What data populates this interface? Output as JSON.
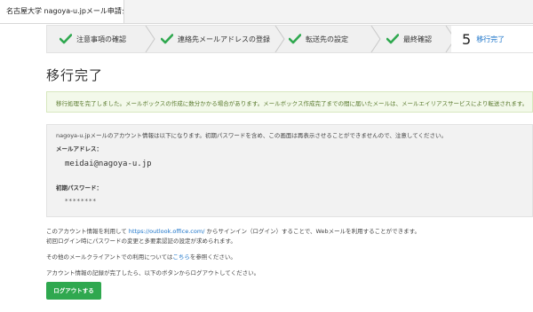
{
  "window": {
    "tab_title": "名古屋大学 nagoya-u.jpメール申請システム"
  },
  "steps": [
    {
      "label": "注意事項の確認",
      "state": "done"
    },
    {
      "label": "連絡先メールアドレスの登録",
      "state": "done"
    },
    {
      "label": "転送先の設定",
      "state": "done"
    },
    {
      "label": "最終確認",
      "state": "done"
    },
    {
      "number": "5",
      "label": "移行完了",
      "state": "current"
    }
  ],
  "page_title": "移行完了",
  "notice": "移行処理を完了しました。メールボックスの作成に数分かかる場合があります。メールボックス作成完了までの間に届いたメールは、メールエイリアスサービスにより転送されます。",
  "account": {
    "intro": "nagoya-u.jpメールのアカウント情報は以下になります。初期パスワードを含め、この画面は再表示させることができませんので、注意してください。",
    "email_label": "メールアドレス：",
    "email_value": "meidai@nagoya-u.jp",
    "password_label": "初期パスワード：",
    "password_value": "********"
  },
  "body_text": {
    "line1_prefix": "このアカウント情報を利用して ",
    "line1_link": "https://outlook.office.com/",
    "line1_suffix": " からサインイン（ログイン）することで、Webメールを利用することができます。",
    "line2": "初回ログイン時にパスワードの変更と多要素認証の設定が求められます。",
    "line3_prefix": "その他のメールクライアントでの利用については",
    "line3_link": "こちら",
    "line3_suffix": "を参照ください。",
    "line4": "アカウント情報の記録が完了したら、以下のボタンからログアウトしてください。"
  },
  "logout_button": "ログアウトする",
  "colors": {
    "accent_green": "#2fa84f",
    "link_blue": "#1a73c9",
    "notice_bg": "#f3f9ea"
  }
}
